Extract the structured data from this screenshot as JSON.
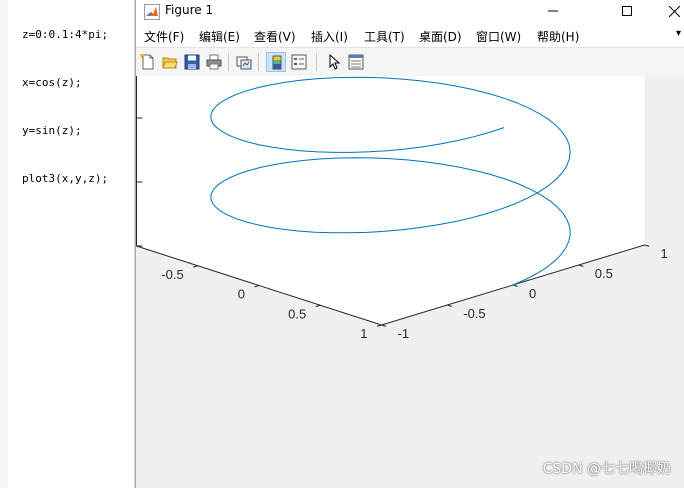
{
  "editor": {
    "code_lines": [
      "z=0:0.1:4*pi;",
      "x=cos(z);",
      "y=sin(z);",
      "plot3(x,y,z);"
    ]
  },
  "window": {
    "title": "Figure 1",
    "controls": [
      "minimize-icon",
      "maximize-icon",
      "close-icon"
    ]
  },
  "menu": {
    "items": [
      "文件(F)",
      "编辑(E)",
      "查看(V)",
      "插入(I)",
      "工具(T)",
      "桌面(D)",
      "窗口(W)",
      "帮助(H)"
    ],
    "overflow": "▾"
  },
  "toolbar": {
    "buttons": [
      "new-figure-icon",
      "open-file-icon",
      "save-icon",
      "print-icon",
      "link-plot-icon",
      "colorbar-icon",
      "legend-icon",
      "pointer-icon",
      "property-inspector-icon"
    ]
  },
  "chart_data": {
    "type": "line",
    "title": "",
    "xlabel": "",
    "ylabel": "",
    "zlabel": "",
    "view": "3d",
    "xlim": [
      -1,
      1
    ],
    "ylim": [
      -1,
      1
    ],
    "zlim": [
      0,
      15
    ],
    "x_ticks": [
      "-1",
      "-0.5",
      "0",
      "0.5",
      "1"
    ],
    "y_ticks": [
      "-1",
      "-0.5",
      "0",
      "0.5",
      "1"
    ],
    "z_ticks": [
      "0",
      "5",
      "10",
      "15"
    ],
    "grid": false,
    "series": [
      {
        "equation": {
          "x": "cos(z)",
          "y": "sin(z)",
          "z": "0:0.1:4*pi"
        },
        "color": "#0072bd"
      }
    ]
  },
  "watermark": "CSDN @七七喝椰奶"
}
